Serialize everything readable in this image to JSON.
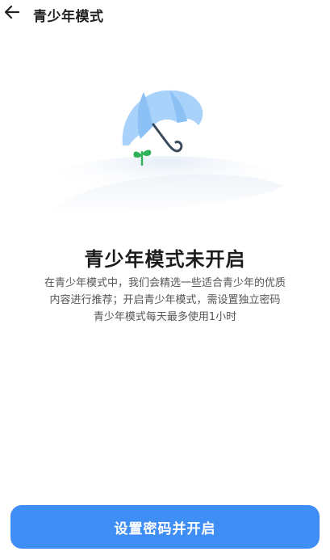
{
  "header": {
    "back_icon": "arrow-left-icon",
    "title": "青少年模式"
  },
  "illustration": {
    "icon": "umbrella-sprout-icon",
    "colors": {
      "umbrella": "#a9d2fb",
      "umbrella_shade": "#8cc1f6",
      "handle": "#3a4a5c",
      "sprout": "#2fb15a"
    }
  },
  "main": {
    "status_title": "青少年模式未开启",
    "description_lines": [
      "在青少年模式中，我们会精选一些适合青少年的优质",
      "内容进行推荐；开启青少年模式，需设置独立密码",
      "青少年模式每天最多使用1小时"
    ]
  },
  "actions": {
    "primary_label": "设置密码并开启",
    "primary_color": "#3f8ef5"
  }
}
